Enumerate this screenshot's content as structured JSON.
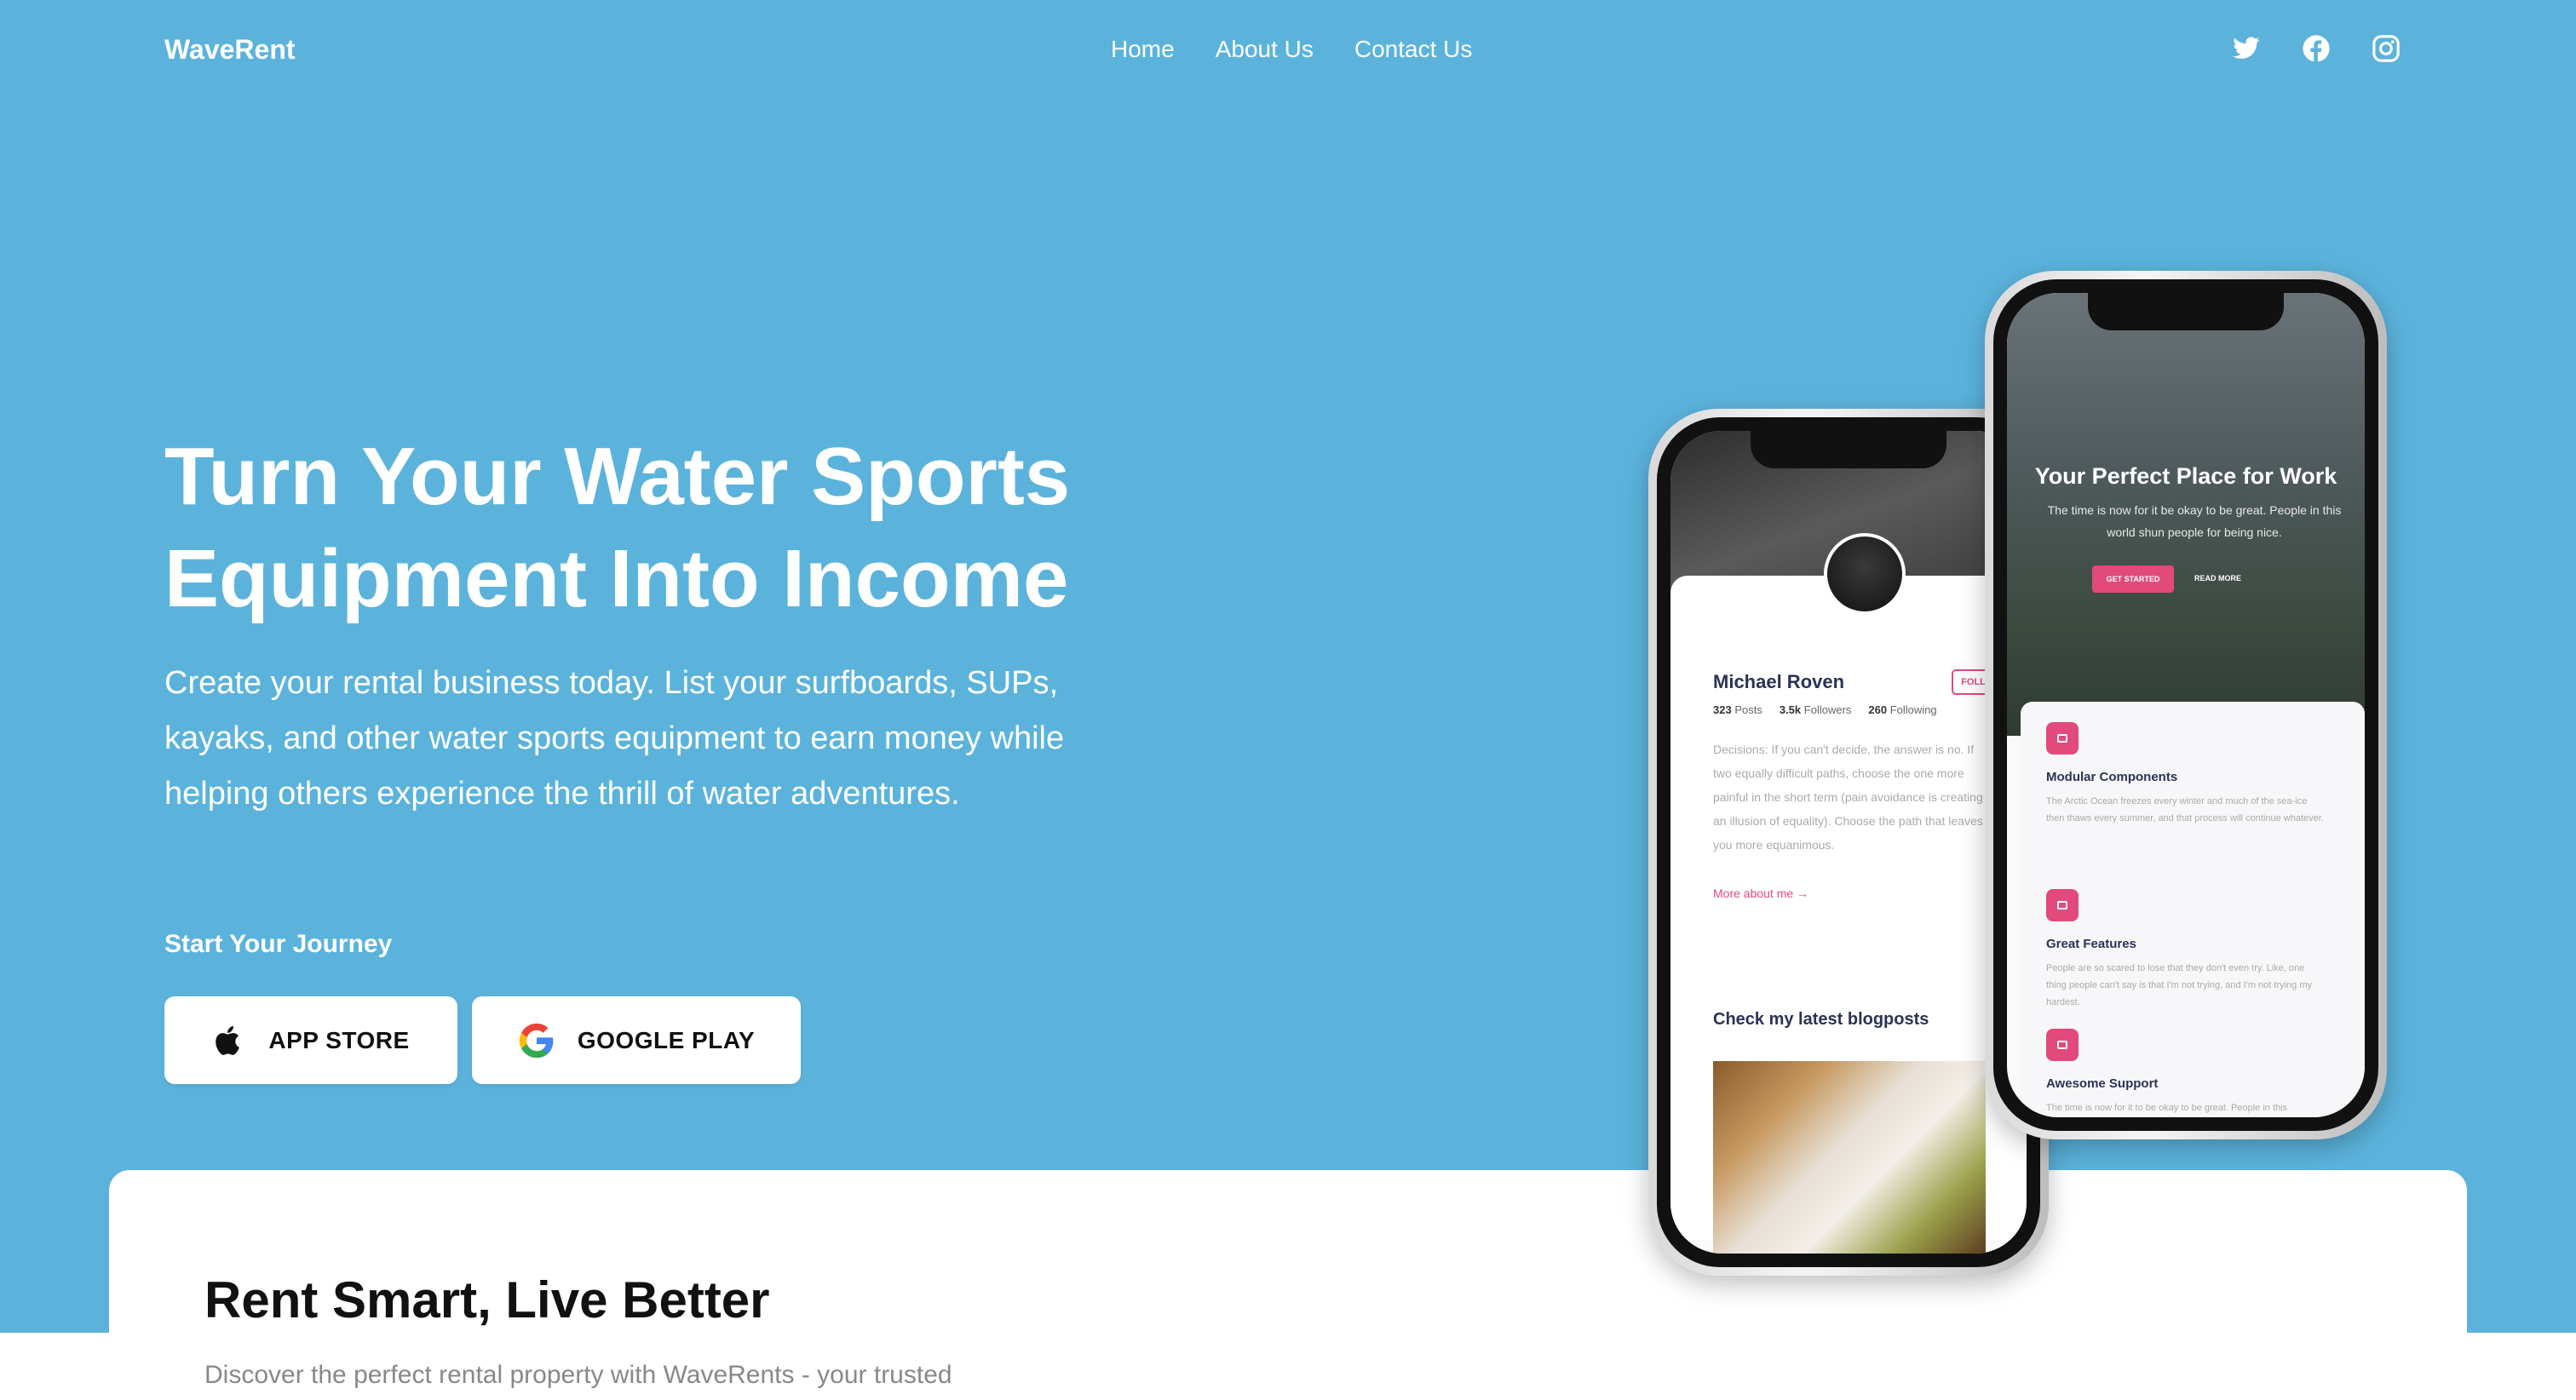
{
  "brand": "WaveRent",
  "nav": {
    "home": "Home",
    "about": "About Us",
    "contact": "Contact Us"
  },
  "socials": [
    "twitter-icon",
    "facebook-icon",
    "instagram-icon"
  ],
  "hero": {
    "headline_line1": "Turn Your Water Sports",
    "headline_line2": "Equipment Into Income",
    "subtext": "Create your rental business today. List your surfboards, SUPs, kayaks, and other water sports equipment to earn money while helping others experience the thrill of water adventures.",
    "cta_label": "Start Your Journey",
    "app_store": "APP STORE",
    "google_play": "GOOGLE PLAY"
  },
  "phone_left": {
    "name": "Michael Roven",
    "follow": "FOLLOW",
    "posts": "323",
    "posts_label": "Posts",
    "followers": "3.5k",
    "followers_label": "Followers",
    "following": "260",
    "following_label": "Following",
    "bio": "Decisions: If you can't decide, the answer is no. If two equally difficult paths, choose the one more painful in the short term (pain avoidance is creating an illusion of equality). Choose the path that leaves you more equanimous.",
    "more": "More about me →",
    "blog_heading": "Check my latest blogposts"
  },
  "phone_right": {
    "title": "Your Perfect Place for Work",
    "subtitle": "The time is now for it be okay to be great. People in this world shun people for being nice.",
    "get_started": "GET STARTED",
    "read_more": "READ MORE",
    "features": [
      {
        "title": "Modular Components",
        "desc": "The Arctic Ocean freezes every winter and much of the sea-ice then thaws every summer, and that process will continue whatever."
      },
      {
        "title": "Great Features",
        "desc": "People are so scared to lose that they don't even try. Like, one thing people can't say is that I'm not trying, and I'm not trying my hardest."
      },
      {
        "title": "Awesome Support",
        "desc": "The time is now for it to be okay to be great. People in this"
      }
    ]
  },
  "section": {
    "title": "Rent Smart, Live Better",
    "text": "Discover the perfect rental property with WaveRents - your trusted"
  },
  "colors": {
    "hero_bg": "#5bb3dc",
    "accent": "#e14a7b"
  }
}
